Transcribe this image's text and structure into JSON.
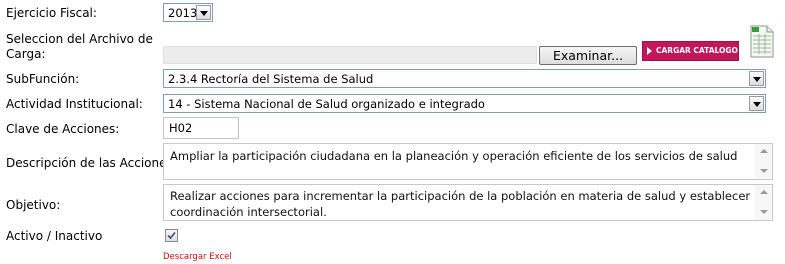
{
  "form": {
    "ejercicio": {
      "label": "Ejercicio Fiscal:",
      "value": "2013"
    },
    "archivo": {
      "label_line1": "Seleccion del Archivo de",
      "label_line2": "Carga:",
      "file_value": "",
      "browse_label": "Examinar...",
      "upload_label": "CARGAR CATALOGO"
    },
    "subfuncion": {
      "label": "SubFunción:",
      "value": "2.3.4 Rectoría del Sistema de Salud"
    },
    "actividad": {
      "label": "Actividad Institucional:",
      "value": "14 - Sistema Nacional de Salud organizado e integrado"
    },
    "clave": {
      "label": "Clave de Acciones:",
      "value": "H02"
    },
    "descripcion": {
      "label": "Descripción de las Acciones:",
      "value": "Ampliar la participación ciudadana en la planeación y operación eficiente de los servicios de salud"
    },
    "objetivo": {
      "label": "Objetivo:",
      "value_line1": "Realizar acciones para incrementar la participación de la población en materia de salud y establecer",
      "value_line2": "coordinación intersectorial."
    },
    "activo": {
      "label": "Activo / Inactivo",
      "checked": true
    },
    "descargar": {
      "label": "Descargar Excel"
    }
  },
  "icons": {
    "spreadsheet": "excel-spreadsheet-icon",
    "checkmark": "checkmark-icon"
  },
  "colors": {
    "accent": "#c2185b",
    "link": "#cc1111"
  }
}
